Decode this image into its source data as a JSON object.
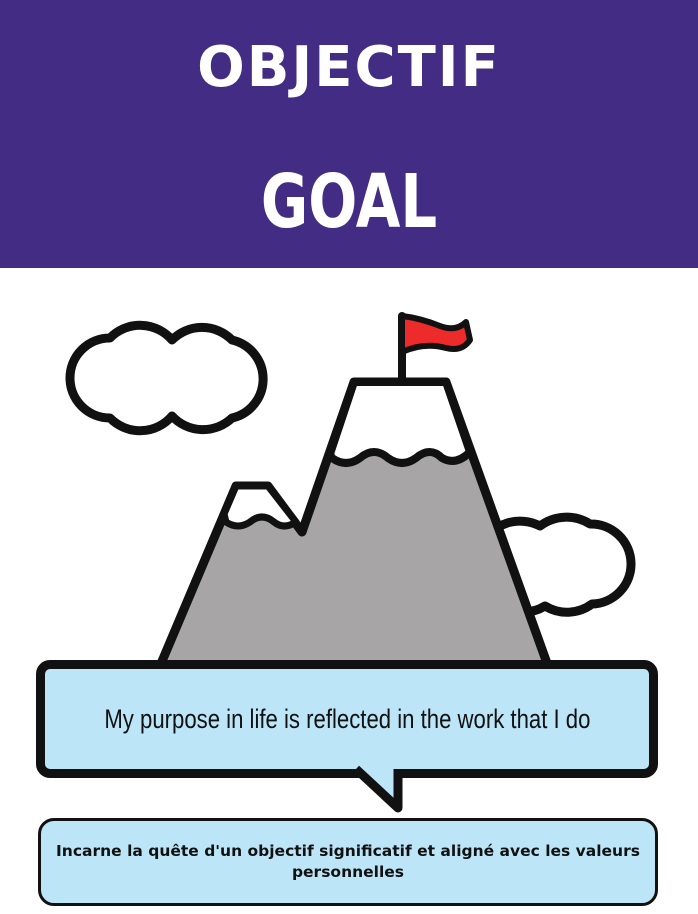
{
  "header": {
    "title_fr": "OBJECTIF",
    "title_en": "GOAL",
    "background_color": "#432d84"
  },
  "illustration": {
    "icons": [
      "cloud-icon",
      "mountain-icon",
      "flag-icon"
    ],
    "flag_color": "#ee2b2b",
    "mountain_color": "#a7a5a6"
  },
  "speech_bubble": {
    "text": "My purpose in life is reflected in the work that I do",
    "fill_color": "#bce6f8"
  },
  "caption": {
    "text": "Incarne la quête d'un objectif significatif et aligné avec les valeurs personnelles"
  }
}
